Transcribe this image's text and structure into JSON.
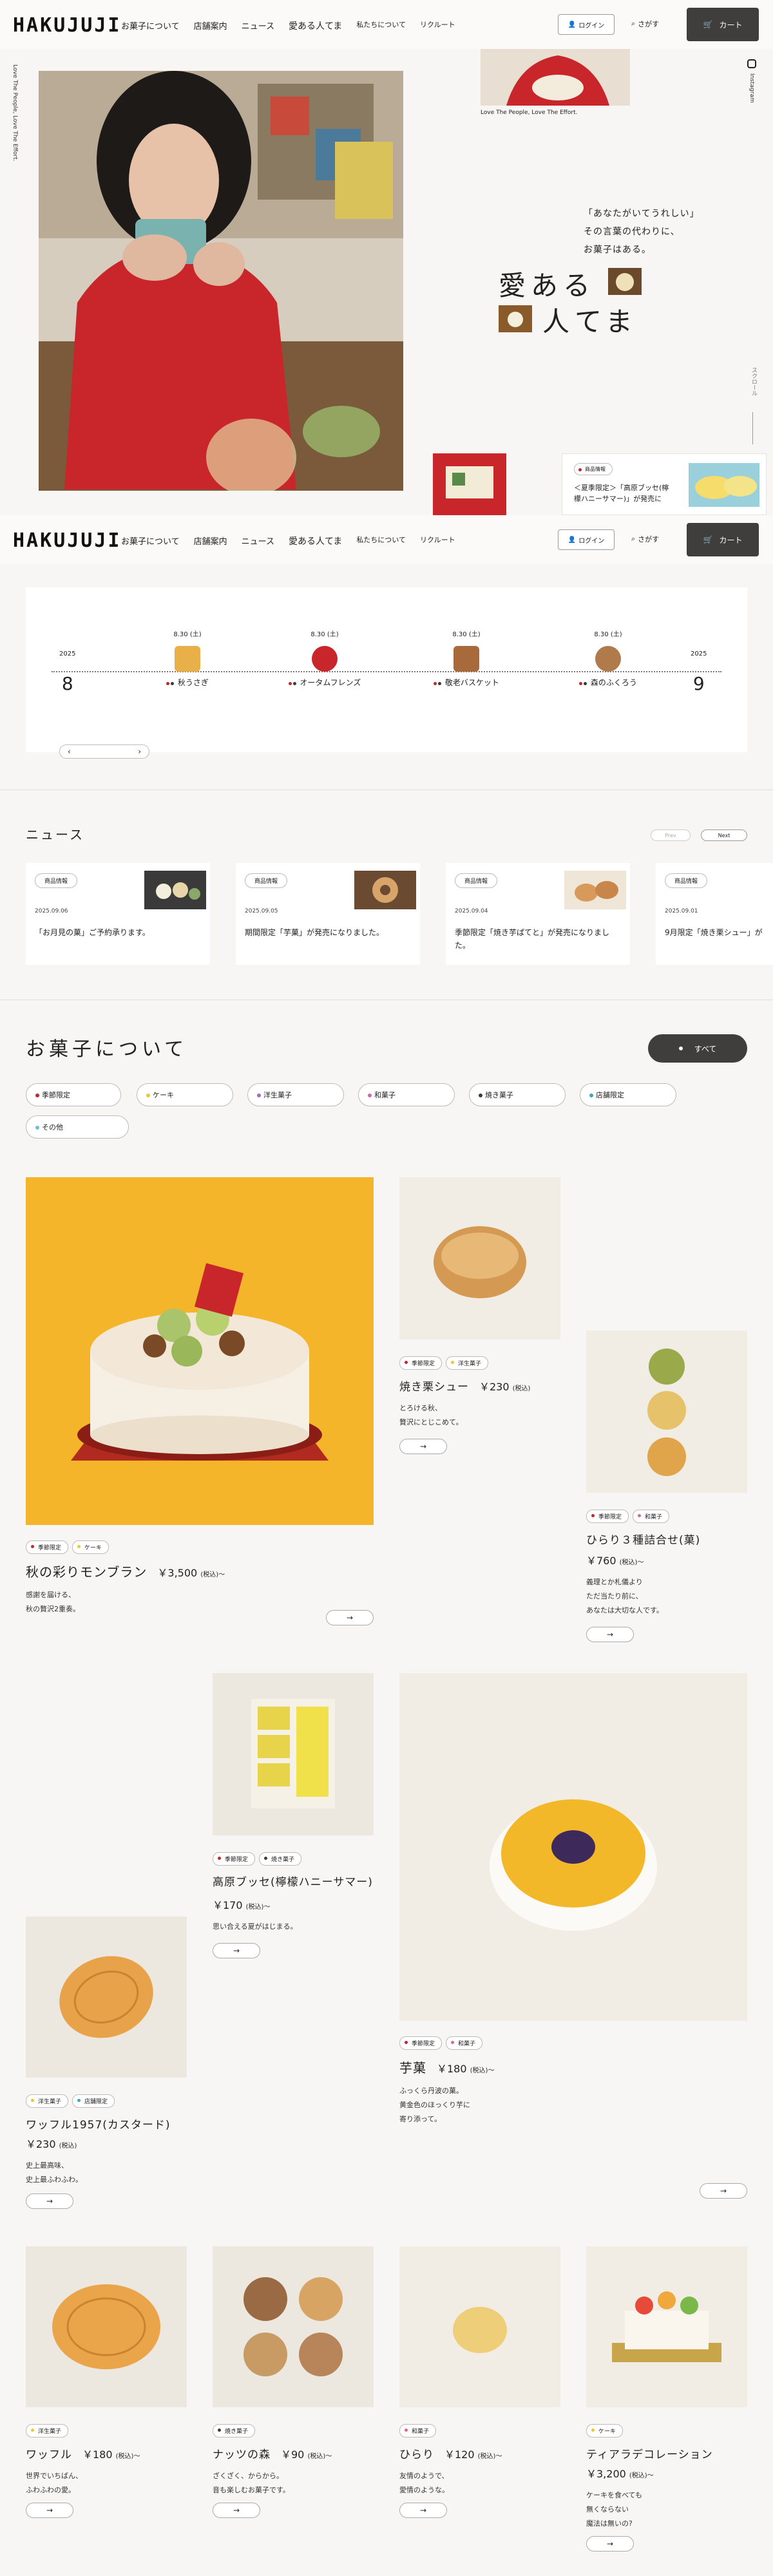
{
  "header": {
    "logo": "HAKUJUJI",
    "nav": [
      "お菓子について",
      "店舗案内",
      "ニュース",
      "愛ある人てま",
      "私たちについて",
      "リクルート"
    ],
    "login": "ログイン",
    "search": "さがす",
    "cart": "カート"
  },
  "hero": {
    "vertical_left": "Love The People, Love The Effort.",
    "caption": "Love The People, Love The Effort.",
    "catch_lines": [
      "「あなたがいてうれしい」",
      "その言葉の代わりに、",
      "お菓子はある。"
    ],
    "title_line1": "愛ある",
    "title_line2": "人てま",
    "instagram": "Instagram",
    "scroll": "スクロール",
    "notice_tag": "商品情報",
    "notice_text": "＜夏季限定＞「高原ブッセ(檸檬ハニーサマー)」が発売に"
  },
  "calendar": {
    "months": [
      {
        "year": "2025",
        "month": "8"
      },
      {
        "year": "2025",
        "month": "9"
      }
    ],
    "items": [
      {
        "date": "8.30 (土)",
        "name": "秋うさぎ"
      },
      {
        "date": "8.30 (土)",
        "name": "オータムフレンズ"
      },
      {
        "date": "8.30 (土)",
        "name": "敬老バスケット"
      },
      {
        "date": "8.30 (土)",
        "name": "森のふくろう"
      }
    ],
    "prev": "‹",
    "next": "›"
  },
  "news": {
    "heading": "ニュース",
    "prev": "Prev",
    "next": "Next",
    "items": [
      {
        "tag": "商品情報",
        "date": "2025.09.06",
        "title": "「お月見の菓」ご予約承ります。"
      },
      {
        "tag": "商品情報",
        "date": "2025.09.05",
        "title": "期間限定「芋菓」が発売になりました。"
      },
      {
        "tag": "商品情報",
        "date": "2025.09.04",
        "title": "季節限定「焼き芋ぱてと」が発売になりました。"
      },
      {
        "tag": "商品情報",
        "date": "2025.09.01",
        "title": "9月限定「焼き栗シュー」が"
      }
    ]
  },
  "about": {
    "heading": "お菓子について",
    "all_button": "すべて",
    "categories": [
      {
        "label": "季節限定",
        "color": "#c0272d"
      },
      {
        "label": "ケーキ",
        "color": "#e8c83a"
      },
      {
        "label": "洋生菓子",
        "color": "#9a6fc0"
      },
      {
        "label": "和菓子",
        "color": "#d26aa0"
      },
      {
        "label": "焼き菓子",
        "color": "#3a3a3a"
      },
      {
        "label": "店舗限定",
        "color": "#3aa8b8"
      },
      {
        "label": "その他",
        "color": "#6ac0d0"
      }
    ]
  },
  "products": [
    {
      "tags": [
        {
          "label": "季節限定",
          "color": "#c0272d"
        },
        {
          "label": "ケーキ",
          "color": "#e8c83a"
        }
      ],
      "name": "秋の彩りモンブラン",
      "price": "￥3,500",
      "tax": "(税込)〜",
      "desc": [
        "感謝を届ける、",
        "秋の贅沢2重奏。"
      ],
      "arrow": "→"
    },
    {
      "tags": [
        {
          "label": "季節限定",
          "color": "#c0272d"
        },
        {
          "label": "洋生菓子",
          "color": "#e8c83a"
        }
      ],
      "name": "焼き栗シュー",
      "price": "￥230",
      "tax": "(税込)",
      "desc": [
        "とろける秋、",
        "贅沢にとじこめて。"
      ],
      "arrow": "→"
    },
    {
      "tags": [
        {
          "label": "季節限定",
          "color": "#c0272d"
        },
        {
          "label": "和菓子",
          "color": "#d26aa0"
        }
      ],
      "name": "ひらり３種詰合せ(菓)",
      "price": "￥760",
      "tax": "(税込)〜",
      "desc": [
        "義理とか札儀より",
        "ただ当たり前に、",
        "あなたは大切な人です。"
      ],
      "arrow": "→"
    },
    {
      "tags": [
        {
          "label": "季節限定",
          "color": "#c0272d"
        },
        {
          "label": "焼き菓子",
          "color": "#3a3a3a"
        }
      ],
      "name": "高原ブッセ(檸檬ハニーサマー)",
      "price": "￥170",
      "tax": "(税込)〜",
      "desc": [
        "思い合える夏がはじまる。"
      ],
      "arrow": "→"
    },
    {
      "tags": [
        {
          "label": "季節限定",
          "color": "#c0272d"
        },
        {
          "label": "和菓子",
          "color": "#d26aa0"
        }
      ],
      "name": "芋菓",
      "price": "￥180",
      "tax": "(税込)〜",
      "desc": [
        "ふっくら丹波の菓。",
        "黄金色のほっくり芋に",
        "寄り添って。"
      ],
      "arrow": "→"
    },
    {
      "tags": [
        {
          "label": "洋生菓子",
          "color": "#e8c83a"
        },
        {
          "label": "店舗限定",
          "color": "#3aa8b8"
        }
      ],
      "name": "ワッフル1957(カスタード)",
      "price": "￥230",
      "tax": "(税込)",
      "desc": [
        "史上最高味、",
        "史上最ふわふわ。"
      ],
      "arrow": "→"
    },
    {
      "tags": [
        {
          "label": "洋生菓子",
          "color": "#e8c83a"
        }
      ],
      "name": "ワッフル",
      "price": "￥180",
      "tax": "(税込)〜",
      "desc": [
        "世界でいちばん、",
        "ふわふわの愛。"
      ],
      "arrow": "→"
    },
    {
      "tags": [
        {
          "label": "焼き菓子",
          "color": "#3a3a3a"
        }
      ],
      "name": "ナッツの森",
      "price": "￥90",
      "tax": "(税込)〜",
      "desc": [
        "ざくざく、からから。",
        "音も楽しむお菓子です。"
      ],
      "arrow": "→"
    },
    {
      "tags": [
        {
          "label": "和菓子",
          "color": "#d26aa0"
        }
      ],
      "name": "ひらり",
      "price": "￥120",
      "tax": "(税込)〜",
      "desc": [
        "友情のようで、",
        "愛情のような。"
      ],
      "arrow": "→"
    },
    {
      "tags": [
        {
          "label": "ケーキ",
          "color": "#e8c83a"
        }
      ],
      "name": "ティアラデコレーション",
      "price": "￥3,200",
      "tax": "(税込)〜",
      "desc": [
        "ケーキを食べても",
        "無くならない",
        "魔法は無いの?"
      ],
      "arrow": "→"
    }
  ],
  "colors": {
    "accent_dark": "#3f3e3c",
    "background": "#f7f6f4",
    "hero_red": "#c8262b",
    "cake_yellow": "#f4b52a"
  }
}
